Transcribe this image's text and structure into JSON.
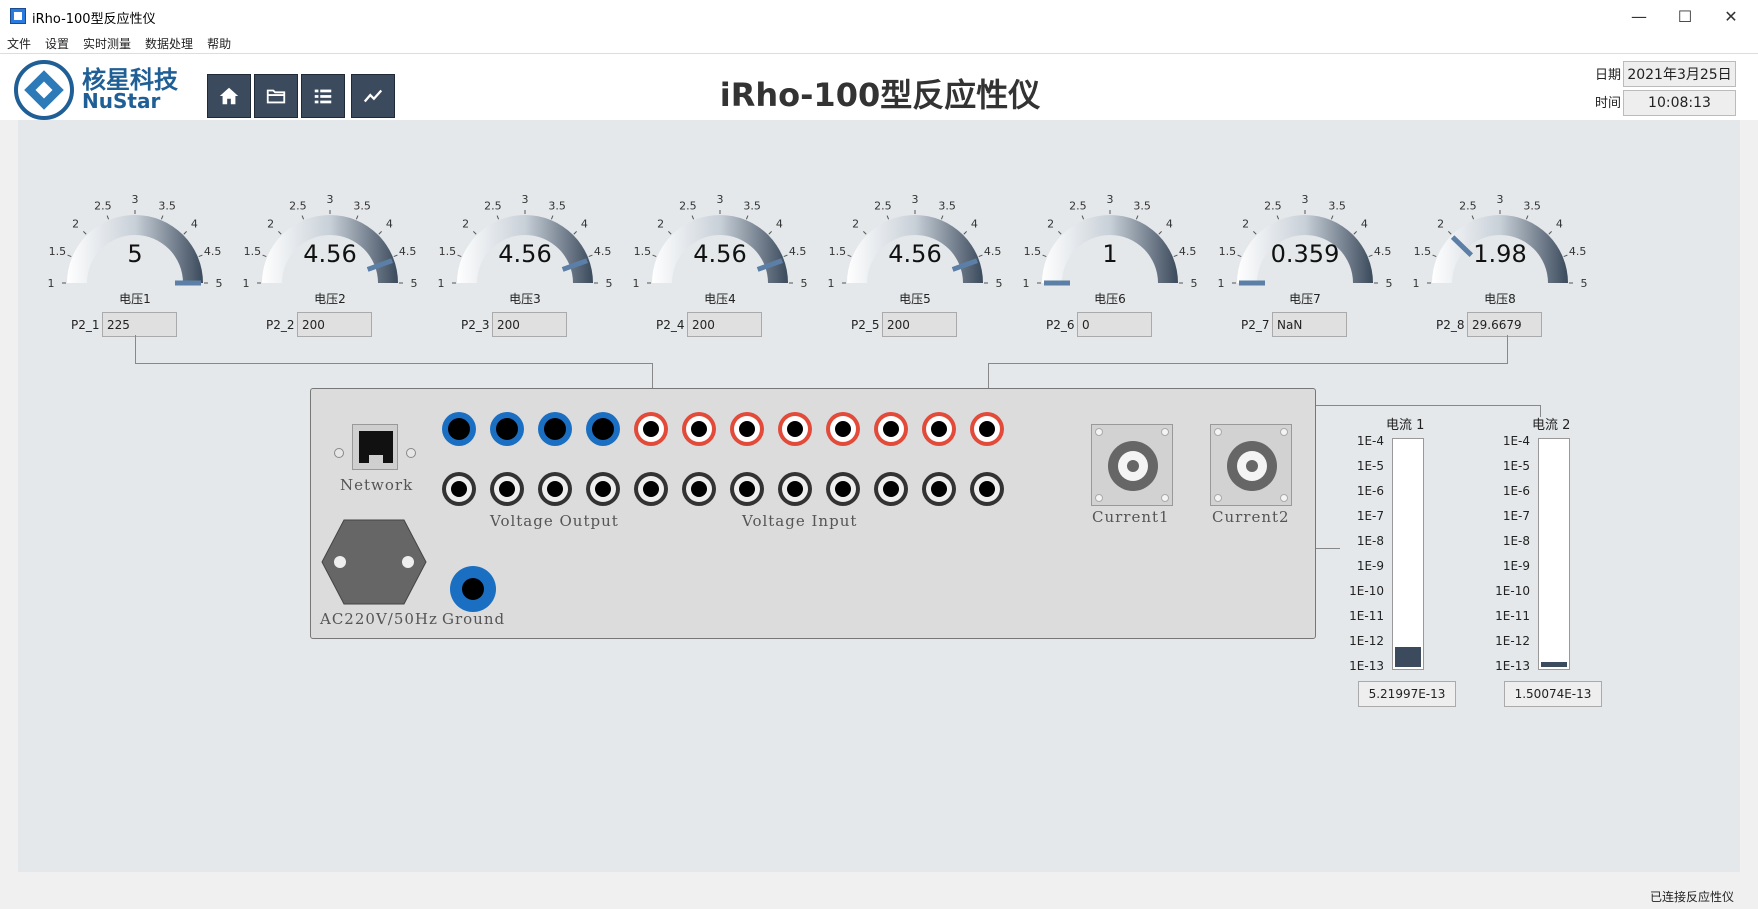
{
  "window": {
    "title": "iRho-100型反应性仪",
    "minimize": "—",
    "maximize": "☐",
    "close": "✕"
  },
  "menu": [
    "文件",
    "设置",
    "实时测量",
    "数据处理",
    "帮助"
  ],
  "logo": {
    "cn": "核星科技",
    "en": "NuStar"
  },
  "header": {
    "title": "iRho-100型反应性仪",
    "date_label": "日期",
    "date_value": "2021年3月25日",
    "time_label": "时间",
    "time_value": "10:08:13"
  },
  "nav_icons": [
    "home-icon",
    "folder-icon",
    "list-icon",
    "trend-chart-icon"
  ],
  "gauge_ticks": [
    "1",
    "1.5",
    "2",
    "2.5",
    "3",
    "3.5",
    "4",
    "4.5",
    "5"
  ],
  "gauges": [
    {
      "value_text": "5",
      "value": 5,
      "label": "电压1",
      "param_label": "P2_1",
      "param_value": "225"
    },
    {
      "value_text": "4.56",
      "value": 4.56,
      "label": "电压2",
      "param_label": "P2_2",
      "param_value": "200"
    },
    {
      "value_text": "4.56",
      "value": 4.56,
      "label": "电压3",
      "param_label": "P2_3",
      "param_value": "200"
    },
    {
      "value_text": "4.56",
      "value": 4.56,
      "label": "电压4",
      "param_label": "P2_4",
      "param_value": "200"
    },
    {
      "value_text": "4.56",
      "value": 4.56,
      "label": "电压5",
      "param_label": "P2_5",
      "param_value": "200"
    },
    {
      "value_text": "1",
      "value": 1,
      "label": "电压6",
      "param_label": "P2_6",
      "param_value": "0"
    },
    {
      "value_text": "0.359",
      "value": 1,
      "label": "电压7",
      "param_label": "P2_7",
      "param_value": "NaN"
    },
    {
      "value_text": "1.98",
      "value": 1.98,
      "label": "电压8",
      "param_label": "P2_8",
      "param_value": "29.6679"
    }
  ],
  "device": {
    "network_label": "Network",
    "voltage_output_label": "Voltage Output",
    "voltage_input_label": "Voltage Input",
    "power_label": "AC220V/50Hz",
    "ground_label": "Ground",
    "current1_label": "Current1",
    "current2_label": "Current2"
  },
  "current_ticks": [
    "1E-4",
    "1E-5",
    "1E-6",
    "1E-7",
    "1E-8",
    "1E-9",
    "1E-10",
    "1E-11",
    "1E-12",
    "1E-13"
  ],
  "currents": [
    {
      "label": "电流 1",
      "value": "5.21997E-13",
      "fill_fraction": 0.09
    },
    {
      "label": "电流 2",
      "value": "1.50074E-13",
      "fill_fraction": 0.02
    }
  ],
  "colors": {
    "gauge_dark": "#3b4a5c",
    "needle": "#5b7fa6",
    "jack_blue": "#1a6fc2",
    "jack_red": "#e24a3a"
  },
  "status": {
    "text": "已连接反应性仪"
  }
}
